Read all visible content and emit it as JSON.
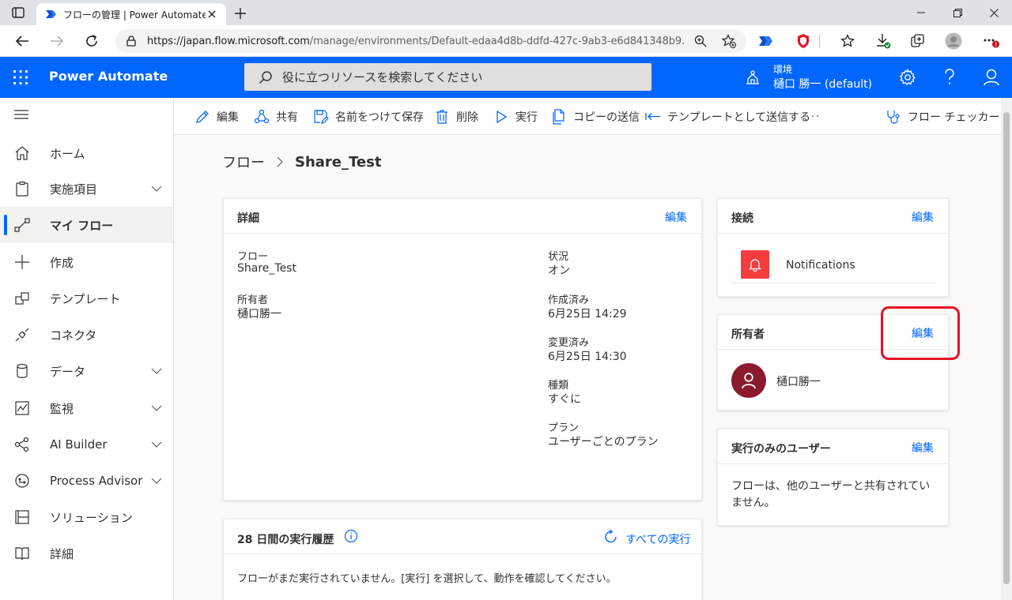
{
  "browser": {
    "tab_title": "フローの管理 | Power Automate",
    "url_host": "https://japan.flow.microsoft.com",
    "url_path": "/manage/environments/Default-edaa4d8b-ddfd-427c-9ab3-e6d841348b9..."
  },
  "header": {
    "app_name": "Power Automate",
    "search_placeholder": "役に立つリソースを検索してください",
    "env_label": "環境",
    "env_name": "樋口 勝一 (default)"
  },
  "sidebar": {
    "items": [
      {
        "label": "ホーム"
      },
      {
        "label": "実施項目"
      },
      {
        "label": "マイ フロー"
      },
      {
        "label": "作成"
      },
      {
        "label": "テンプレート"
      },
      {
        "label": "コネクタ"
      },
      {
        "label": "データ"
      },
      {
        "label": "監視"
      },
      {
        "label": "AI Builder"
      },
      {
        "label": "Process Advisor"
      },
      {
        "label": "ソリューション"
      },
      {
        "label": "詳細"
      }
    ]
  },
  "commandbar": {
    "edit": "編集",
    "share": "共有",
    "save_as": "名前をつけて保存",
    "delete": "削除",
    "run": "実行",
    "send_copy": "コピーの送信",
    "send_template": "テンプレートとして送信する",
    "more": "···",
    "flow_checker": "フロー チェッカー"
  },
  "breadcrumb": {
    "parent": "フロー",
    "current": "Share_Test"
  },
  "details": {
    "title": "詳細",
    "edit": "編集",
    "flow_label": "フロー",
    "flow_value": "Share_Test",
    "owner_label": "所有者",
    "owner_value": "樋口勝一",
    "status_label": "状況",
    "status_value": "オン",
    "created_label": "作成済み",
    "created_value": "6月25日 14:29",
    "modified_label": "変更済み",
    "modified_value": "6月25日 14:30",
    "type_label": "種類",
    "type_value": "すぐに",
    "plan_label": "プラン",
    "plan_value": "ユーザーごとのプラン"
  },
  "connections": {
    "title": "接続",
    "edit": "編集",
    "item": "Notifications"
  },
  "owners": {
    "title": "所有者",
    "edit": "編集",
    "name": "樋口勝一"
  },
  "run_only": {
    "title": "実行のみのユーザー",
    "edit": "編集",
    "message": "フローは、他のユーザーと共有されていません。"
  },
  "history": {
    "title": "28 日間の実行履歴",
    "all_runs": "すべての実行",
    "message": "フローがまだ実行されていません。[実行] を選択して、動作を確認してください。"
  },
  "colors": {
    "accent": "#0066ff",
    "highlight": "#e81123",
    "notification": "#f53d3d",
    "avatar": "#8b1a2f"
  }
}
